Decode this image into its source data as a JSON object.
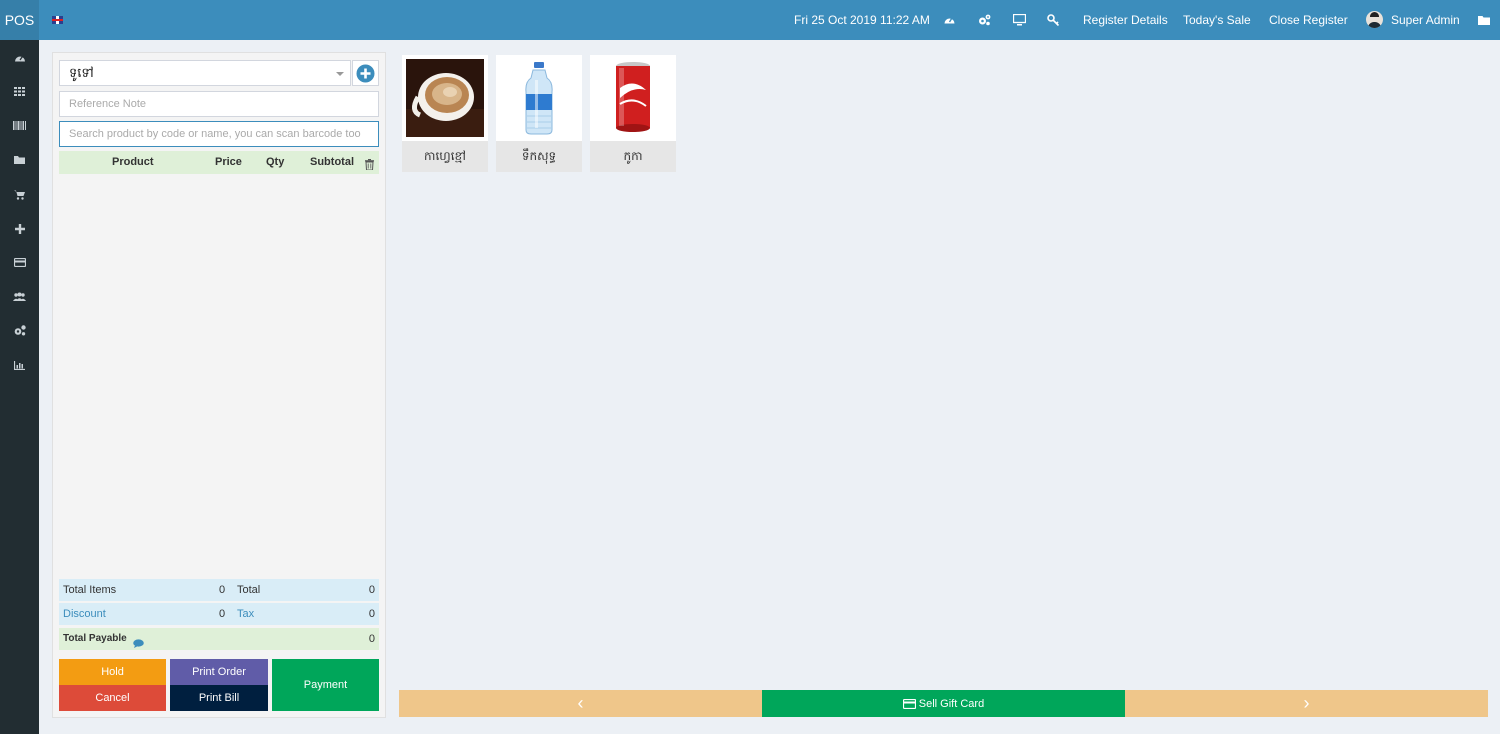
{
  "app": {
    "logo": "POS",
    "language_flag": "flag-uk-icon"
  },
  "header": {
    "datetime": "Fri 25 Oct 2019 11:22 AM",
    "icons": [
      "dashboard-icon",
      "settings-icon",
      "monitor-icon",
      "key-icon"
    ],
    "register_details": "Register Details",
    "todays_sale": "Today's Sale",
    "close_register": "Close Register",
    "user_name": "Super Admin",
    "folder_icon": "folder-icon"
  },
  "sidebar": {
    "icons": [
      "dashboard-icon",
      "grid-icon",
      "barcode-icon",
      "folder-icon",
      "cart-icon",
      "plus-icon",
      "credit-card-icon",
      "users-icon",
      "settings-icon",
      "chart-icon"
    ]
  },
  "order": {
    "customer": "ទូទៅ",
    "reference_placeholder": "Reference Note",
    "search_placeholder": "Search product by code or name, you can scan barcode too",
    "columns": {
      "product": "Product",
      "price": "Price",
      "qty": "Qty",
      "subtotal": "Subtotal"
    },
    "totals": {
      "total_items_label": "Total Items",
      "total_items": "0",
      "total_label": "Total",
      "total": "0",
      "discount_label": "Discount",
      "discount": "0",
      "tax_label": "Tax",
      "tax": "0",
      "total_payable_label": "Total Payable",
      "total_payable": "0"
    },
    "buttons": {
      "hold": "Hold",
      "print_order": "Print Order",
      "cancel": "Cancel",
      "print_bill": "Print Bill",
      "payment": "Payment"
    },
    "colors": {
      "hold": "#f39c12",
      "print_order": "#605ca8",
      "cancel": "#dd4b39",
      "print_bill": "#001f3f",
      "payment": "#00a65a"
    }
  },
  "products": [
    {
      "name": "កាហ្វេខ្មៅ",
      "image": "coffee-cup-image"
    },
    {
      "name": "ទឹកសុទ្ធ",
      "image": "water-bottle-image"
    },
    {
      "name": "កូកា",
      "image": "cola-can-image"
    }
  ],
  "footer": {
    "sell_gift_card": "Sell Gift Card",
    "prev": "‹",
    "next": "›"
  }
}
